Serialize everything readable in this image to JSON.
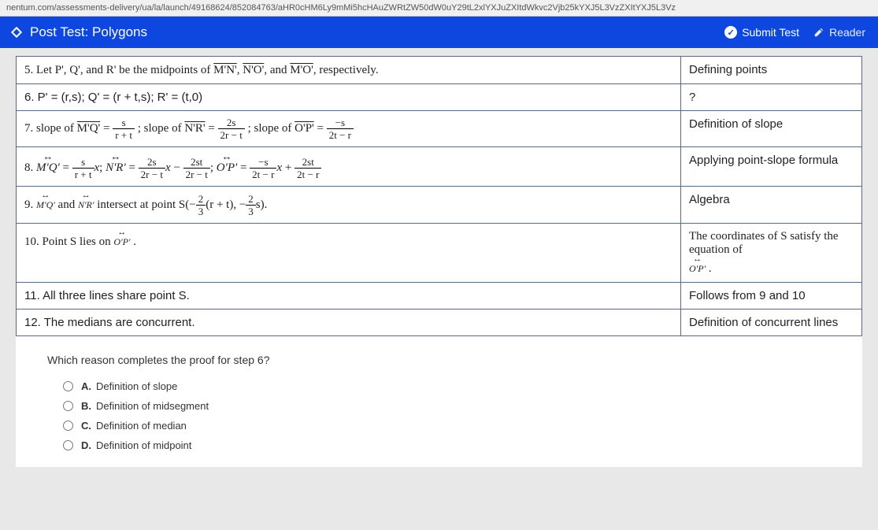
{
  "url": "nentum.com/assessments-delivery/ua/la/launch/49168624/852084763/aHR0cHM6Ly9mMi5hcHAuZWRtZW50dW0uY29tL2xlYXJuZXItdWkvc2Vjb25kYXJ5L3VzZXItYXJ5L3Vz",
  "header": {
    "title": "Post Test: Polygons",
    "submit": "Submit Test",
    "reader": "Reader"
  },
  "rows": {
    "r5": {
      "step": "5. Let P', Q', and R' be the midpoints of M'N', N'O', and M'O', respectively.",
      "reason": "Defining points"
    },
    "r6": {
      "step": "6. P' = (r,s); Q' = (r + t,s); R' = (t,0)",
      "reason": "?"
    },
    "r7": {
      "prefix": "7. slope of ",
      "mid1": " = ",
      "mid2": "; slope of ",
      "mid3": " = ",
      "mid4": "; slope of ",
      "mid5": " = ",
      "reason": "Definition of slope"
    },
    "r8": {
      "prefix": "8. ",
      "reason": "Applying point-slope formula"
    },
    "r9": {
      "prefix": "9. ",
      "mid": " intersect at point ",
      "reason": "Algebra"
    },
    "r10": {
      "text": "10. Point S lies on ",
      "reason": "The coordinates of S satisfy the equation of "
    },
    "r11": {
      "step": "11. All three lines share point S.",
      "reason": "Follows from 9 and 10"
    },
    "r12": {
      "step": "12. The medians are concurrent.",
      "reason": "Definition of concurrent lines"
    }
  },
  "fracs": {
    "f7a": {
      "num": "s",
      "den": "r + t"
    },
    "f7b": {
      "num": "2s",
      "den": "2r − t"
    },
    "f7c": {
      "num": "−s",
      "den": "2t − r"
    },
    "f8a": {
      "num": "s",
      "den": "r + t"
    },
    "f8b": {
      "num": "2s",
      "den": "2r − t"
    },
    "f8c": {
      "num": "2st",
      "den": "2r − t"
    },
    "f8d": {
      "num": "−s",
      "den": "2t − r"
    },
    "f8e": {
      "num": "2st",
      "den": "2t − r"
    },
    "f9a": {
      "num": "2",
      "den": "3"
    },
    "f9b": {
      "num": "2",
      "den": "3"
    }
  },
  "labels": {
    "mq": "M'Q'",
    "nr": "N'R'",
    "op": "O'P'",
    "and": " and ",
    "eq": " = ",
    "semi": "; ",
    "x": "x",
    "minus": " − ",
    "plus": " + ",
    "s_open": "S(−",
    "rt": "(r + t), −",
    "s_close": "s).",
    "dot": " ."
  },
  "question": {
    "text": "Which reason completes the proof for step 6?",
    "options": {
      "a": {
        "letter": "A.",
        "text": "Definition of slope"
      },
      "b": {
        "letter": "B.",
        "text": "Definition of midsegment"
      },
      "c": {
        "letter": "C.",
        "text": "Definition of median"
      },
      "d": {
        "letter": "D.",
        "text": "Definition of midpoint"
      }
    }
  }
}
